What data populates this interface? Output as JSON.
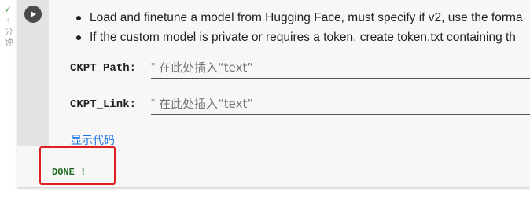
{
  "cell_status": {
    "check_icon": "✓",
    "elapsed": "1分钟"
  },
  "colors": {
    "run_button": "#4a4a4a",
    "link": "#1a73e8",
    "output_text": "#1f6b1f",
    "highlight": "#e02020"
  },
  "cell": {
    "bullets": [
      "Load and finetune a model from Hugging Face, must specify if v2, use the forma",
      "If the custom model is private or requires a token, create token.txt containing th"
    ],
    "form_fields": [
      {
        "label": "CKPT_Path:",
        "quote": "\"",
        "placeholder": "在此处插入“text”",
        "value": ""
      },
      {
        "label": "CKPT_Link:",
        "quote": "\"",
        "placeholder": "在此处插入“text”",
        "value": ""
      }
    ],
    "show_code_label": "显示代码"
  },
  "output": {
    "text": "DONE !"
  }
}
